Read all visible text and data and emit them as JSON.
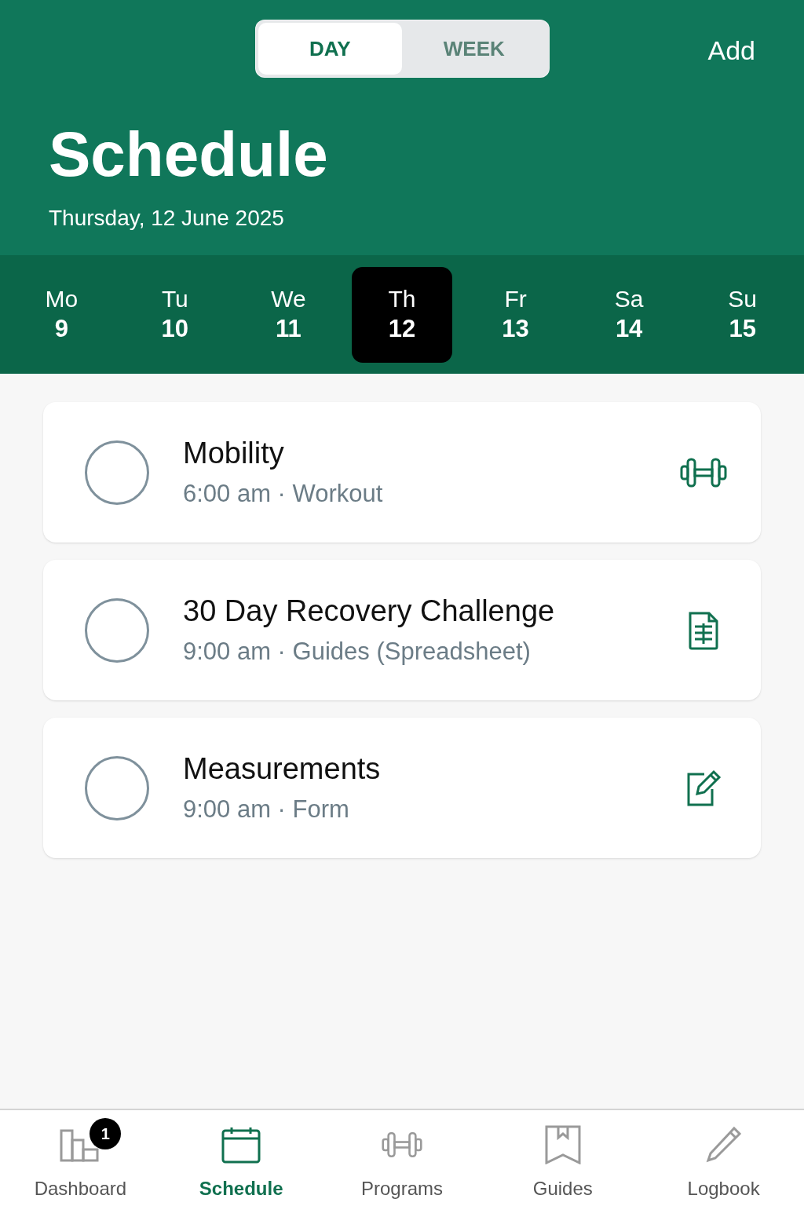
{
  "header": {
    "segments": [
      {
        "label": "DAY",
        "selected": true
      },
      {
        "label": "WEEK",
        "selected": false
      }
    ],
    "add": "Add",
    "title": "Schedule",
    "date": "Thursday, 12 June 2025"
  },
  "days": [
    {
      "weekday": "Mo",
      "date": "9",
      "selected": false
    },
    {
      "weekday": "Tu",
      "date": "10",
      "selected": false
    },
    {
      "weekday": "We",
      "date": "11",
      "selected": false
    },
    {
      "weekday": "Th",
      "date": "12",
      "selected": true
    },
    {
      "weekday": "Fr",
      "date": "13",
      "selected": false
    },
    {
      "weekday": "Sa",
      "date": "14",
      "selected": false
    },
    {
      "weekday": "Su",
      "date": "15",
      "selected": false
    }
  ],
  "items": [
    {
      "title": "Mobility",
      "subtitle": "6:00 am · Workout",
      "kind": "workout",
      "checked": false
    },
    {
      "title": "30 Day Recovery Challenge",
      "subtitle": "9:00 am · Guides (Spreadsheet)",
      "kind": "spreadsheet",
      "checked": false
    },
    {
      "title": "Measurements",
      "subtitle": "9:00 am · Form",
      "kind": "form",
      "checked": false
    }
  ],
  "tab_bar": [
    {
      "label": "Dashboard",
      "kind": "dashboard",
      "selected": false,
      "badge": "1"
    },
    {
      "label": "Schedule",
      "kind": "schedule",
      "selected": true
    },
    {
      "label": "Programs",
      "kind": "programs",
      "selected": false
    },
    {
      "label": "Guides",
      "kind": "guides",
      "selected": false
    },
    {
      "label": "Logbook",
      "kind": "logbook",
      "selected": false
    }
  ]
}
